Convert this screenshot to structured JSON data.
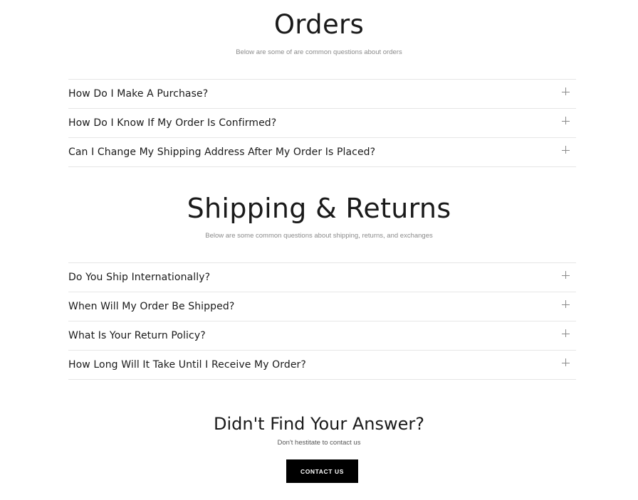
{
  "orders": {
    "title": "Orders",
    "subtitle": "Below are some of are common questions about orders",
    "questions": [
      "How Do I Make A Purchase?",
      "How Do I Know If My Order Is Confirmed?",
      "Can I Change My Shipping Address After My Order Is Placed?"
    ]
  },
  "shipping": {
    "title": "Shipping & Returns",
    "subtitle": "Below are some common questions about shipping, returns, and exchanges",
    "questions": [
      "Do You Ship Internationally?",
      "When Will My Order Be Shipped?",
      "What Is Your Return Policy?",
      "How Long Will It Take Until I Receive My Order?"
    ]
  },
  "cta": {
    "title": "Didn't Find Your Answer?",
    "subtitle": "Don't hestitate to contact us",
    "button_label": "CONTACT US"
  },
  "icons": {
    "expand": "plus-icon"
  },
  "colors": {
    "text": "#1a1a1a",
    "muted": "#8a8a8a",
    "divider": "#e6e6e6",
    "button_bg": "#000000",
    "button_text": "#ffffff"
  }
}
